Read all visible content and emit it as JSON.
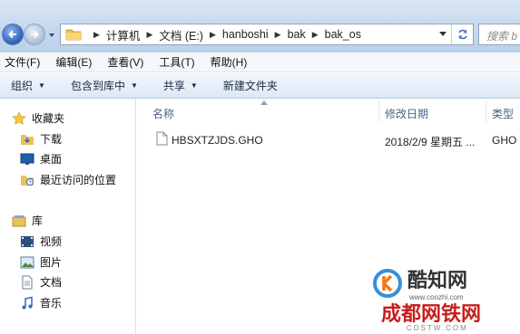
{
  "address": {
    "crumbs": [
      "计算机",
      "文档 (E:)",
      "hanboshi",
      "bak",
      "bak_os"
    ]
  },
  "search": {
    "placeholder": "搜索 b"
  },
  "menu": [
    "文件(F)",
    "编辑(E)",
    "查看(V)",
    "工具(T)",
    "帮助(H)"
  ],
  "commands": {
    "organize": "组织",
    "include_library": "包含到库中",
    "share": "共享",
    "new_folder": "新建文件夹"
  },
  "nav": {
    "favorites": "收藏夹",
    "downloads": "下载",
    "desktop": "桌面",
    "recent": "最近访问的位置",
    "libraries": "库",
    "videos": "视频",
    "pictures": "图片",
    "documents": "文档",
    "music": "音乐"
  },
  "columns": {
    "name": "名称",
    "modified": "修改日期",
    "type": "类型"
  },
  "files": [
    {
      "name": "HBSXTZJDS.GHO",
      "modified": "2018/2/9 星期五 ...",
      "type": "GHO"
    }
  ],
  "watermark": {
    "brand1": "酷知网",
    "url1": "www.coozhi.com",
    "brand2": "成都网铁网",
    "url2": "CDSTW.COM"
  },
  "colors": {
    "accent": "#2b5fb8",
    "header_text": "#4d6185"
  }
}
